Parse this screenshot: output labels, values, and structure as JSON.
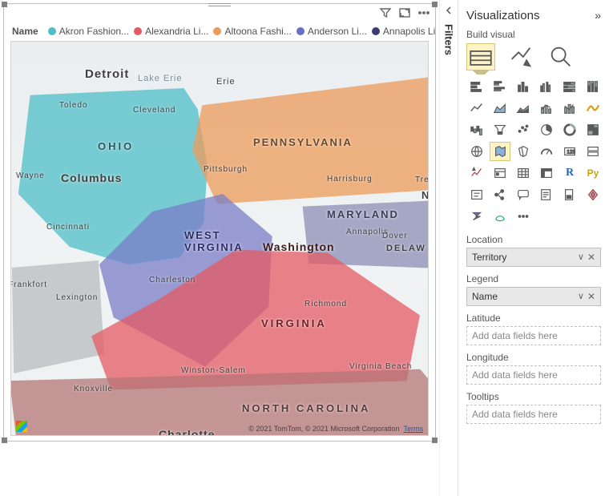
{
  "legend": {
    "label": "Name",
    "items": [
      {
        "label": "Akron Fashion...",
        "color": "#4fbdc7"
      },
      {
        "label": "Alexandria Li...",
        "color": "#e45a63"
      },
      {
        "label": "Altoona Fashi...",
        "color": "#ec9b59"
      },
      {
        "label": "Anderson Li...",
        "color": "#6a6fc1"
      },
      {
        "label": "Annapolis Li...",
        "color": "#3c3c72"
      }
    ]
  },
  "header_icons": {
    "filter": "filter",
    "focus": "focus",
    "more": "more"
  },
  "filters_rail": {
    "label": "Filters"
  },
  "places": {
    "detroit": "Detroit",
    "lake_erie": "Lake Erie",
    "erie": "Erie",
    "toledo": "Toledo",
    "cleveland": "Cleveland",
    "ohio": "OHIO",
    "wayne": "Wayne",
    "columbus": "Columbus",
    "pitt": "Pittsburgh",
    "pa": "PENNSYLVANIA",
    "harris": "Harrisburg",
    "trenton": "Trenton",
    "newj": "NEW",
    "cinc": "Cincinnati",
    "md": "MARYLAND",
    "wv": "WEST\nVIRGINIA",
    "wash": "Washington",
    "annap": "Annapolis",
    "dover": "Dover",
    "dela": "DELAW",
    "charl": "Charleston",
    "frank": "Frankfort",
    "lex": "Lexington",
    "rich": "Richmond",
    "va": "VIRGINIA",
    "vb": "Virginia Beach",
    "knox": "Knoxville",
    "ws": "Winston-Salem",
    "nc": "NORTH CAROLINA",
    "charlotte": "Charlotte"
  },
  "attribution": {
    "text": "© 2021 TomTom, © 2021 Microsoft Corporation",
    "link": "Terms"
  },
  "viz_pane": {
    "title": "Visualizations",
    "build": "Build visual",
    "sections": {
      "location": {
        "label": "Location",
        "value": "Territory"
      },
      "legend": {
        "label": "Legend",
        "value": "Name"
      },
      "latitude": {
        "label": "Latitude",
        "placeholder": "Add data fields here"
      },
      "longitude": {
        "label": "Longitude",
        "placeholder": "Add data fields here"
      },
      "tooltips": {
        "label": "Tooltips",
        "placeholder": "Add data fields here"
      }
    },
    "icons": [
      "stacked-bar",
      "clustered-bar",
      "stacked-col",
      "clustered-col",
      "stacked100-bar",
      "stacked100-col",
      "line",
      "area",
      "stacked-area",
      "line-col",
      "line-col2",
      "ribbon",
      "waterfall",
      "funnel",
      "scatter",
      "pie",
      "donut",
      "treemap",
      "map",
      "filled-map",
      "shape-map",
      "gauge",
      "card-num",
      "multi-card",
      "kpi",
      "slicer",
      "table",
      "matrix",
      "r-visual",
      "python-visual",
      "key-inf",
      "decomp",
      "qna",
      "narrative",
      "paginated",
      "powerapps",
      "powerautomate",
      "arcgis",
      "more-viz"
    ]
  }
}
